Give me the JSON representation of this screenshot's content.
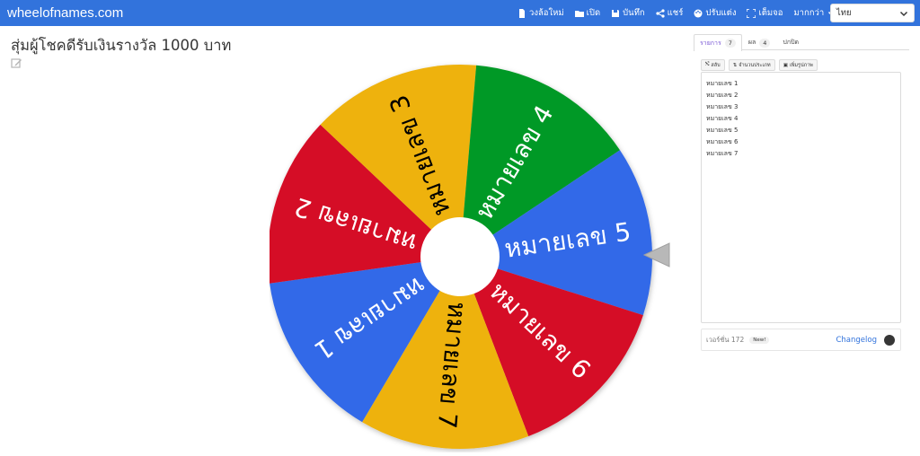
{
  "header": {
    "brand": "wheelofnames.com",
    "nav": [
      {
        "label": "วงล้อใหม่",
        "icon": "file-icon"
      },
      {
        "label": "เปิด",
        "icon": "folder-icon"
      },
      {
        "label": "บันทึก",
        "icon": "save-icon"
      },
      {
        "label": "แชร์",
        "icon": "share-icon"
      },
      {
        "label": "ปรับแต่ง",
        "icon": "palette-icon"
      },
      {
        "label": "เต็มจอ",
        "icon": "fullscreen-icon"
      },
      {
        "label": "มากกว่า",
        "icon": "chevron-down-icon"
      }
    ],
    "language": "ไทย",
    "bar_color": "#3273dc"
  },
  "page": {
    "title": "สุ่มผู้โชคดีรับเงินรางวัล 1000 บาท"
  },
  "wheel": {
    "segments": [
      {
        "label": "หมายเลข 1",
        "color": "#3369e8"
      },
      {
        "label": "หมายเลข 2",
        "color": "#d50f25"
      },
      {
        "label": "หมายเลข 3",
        "color": "#eeb211"
      },
      {
        "label": "หมายเลข 4",
        "color": "#009925"
      },
      {
        "label": "หมายเลข 5",
        "color": "#3369e8"
      },
      {
        "label": "หมายเลข 6",
        "color": "#d50f25"
      },
      {
        "label": "หมายเลข 7",
        "color": "#eeb211"
      }
    ],
    "pointer_color": "#b8b8b8"
  },
  "panel": {
    "tabs": [
      {
        "label": "รายการ",
        "count": "7"
      },
      {
        "label": "ผล",
        "count": "4"
      },
      {
        "label": "ปกปิด",
        "count": ""
      }
    ],
    "tools": [
      {
        "label": "สลับ",
        "icon": "shuffle-icon"
      },
      {
        "label": "จำนวนประเภท",
        "icon": "sort-icon"
      },
      {
        "label": "เพิ่มรูปภาพ",
        "icon": "image-icon"
      }
    ],
    "entries": [
      "หมายเลข 1",
      "หมายเลข 2",
      "หมายเลข 3",
      "หมายเลข 4",
      "หมายเลข 5",
      "หมายเลข 6",
      "หมายเลข 7"
    ],
    "version_text": "เวอร์ชั่น 172",
    "new_badge": "New!",
    "changelog": "Changelog"
  }
}
